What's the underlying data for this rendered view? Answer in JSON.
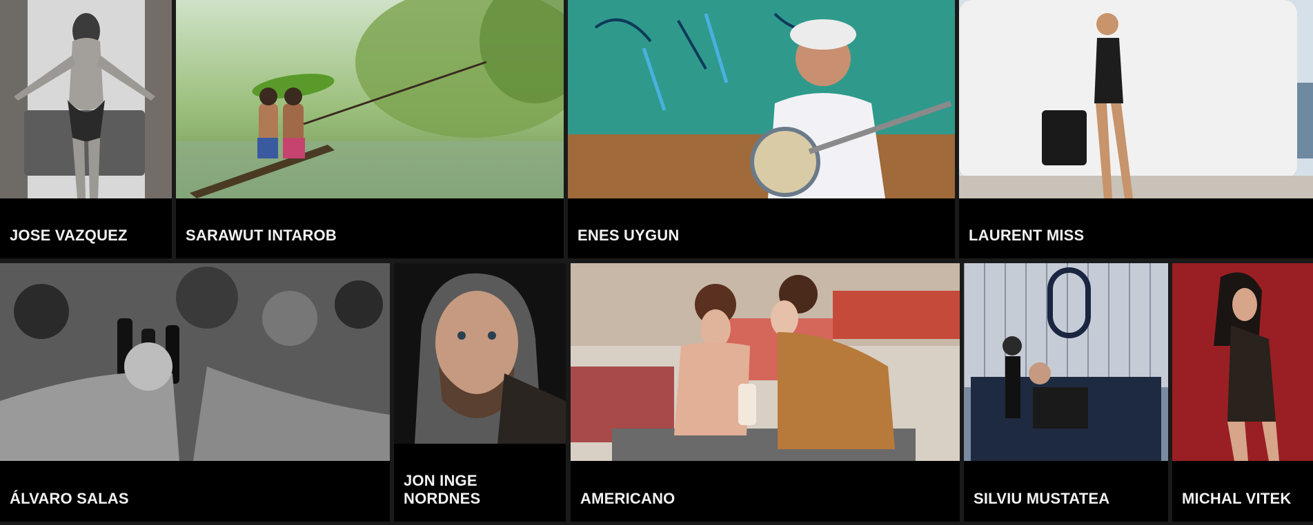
{
  "gallery": {
    "row1": [
      {
        "label": "JOSE VAZQUEZ",
        "icon": "photo-woman-doorway"
      },
      {
        "label": "SARAWUT INTAROB",
        "icon": "photo-boys-fishing"
      },
      {
        "label": "ENES UYGUN",
        "icon": "photo-banjo-man"
      },
      {
        "label": "LAURENT MISS",
        "icon": "photo-woman-handbag"
      }
    ],
    "row2": [
      {
        "label": "ÁLVARO SALAS",
        "icon": "photo-beer-toast"
      },
      {
        "label": "JON INGE\nNORDNES",
        "icon": "photo-hooded-man"
      },
      {
        "label": "AMERICANO",
        "icon": "photo-diner-women"
      },
      {
        "label": "SILVIU MUSTATEA",
        "icon": "photo-club-dancers"
      },
      {
        "label": "MICHAL VITEK",
        "icon": "photo-woman-red"
      }
    ]
  }
}
